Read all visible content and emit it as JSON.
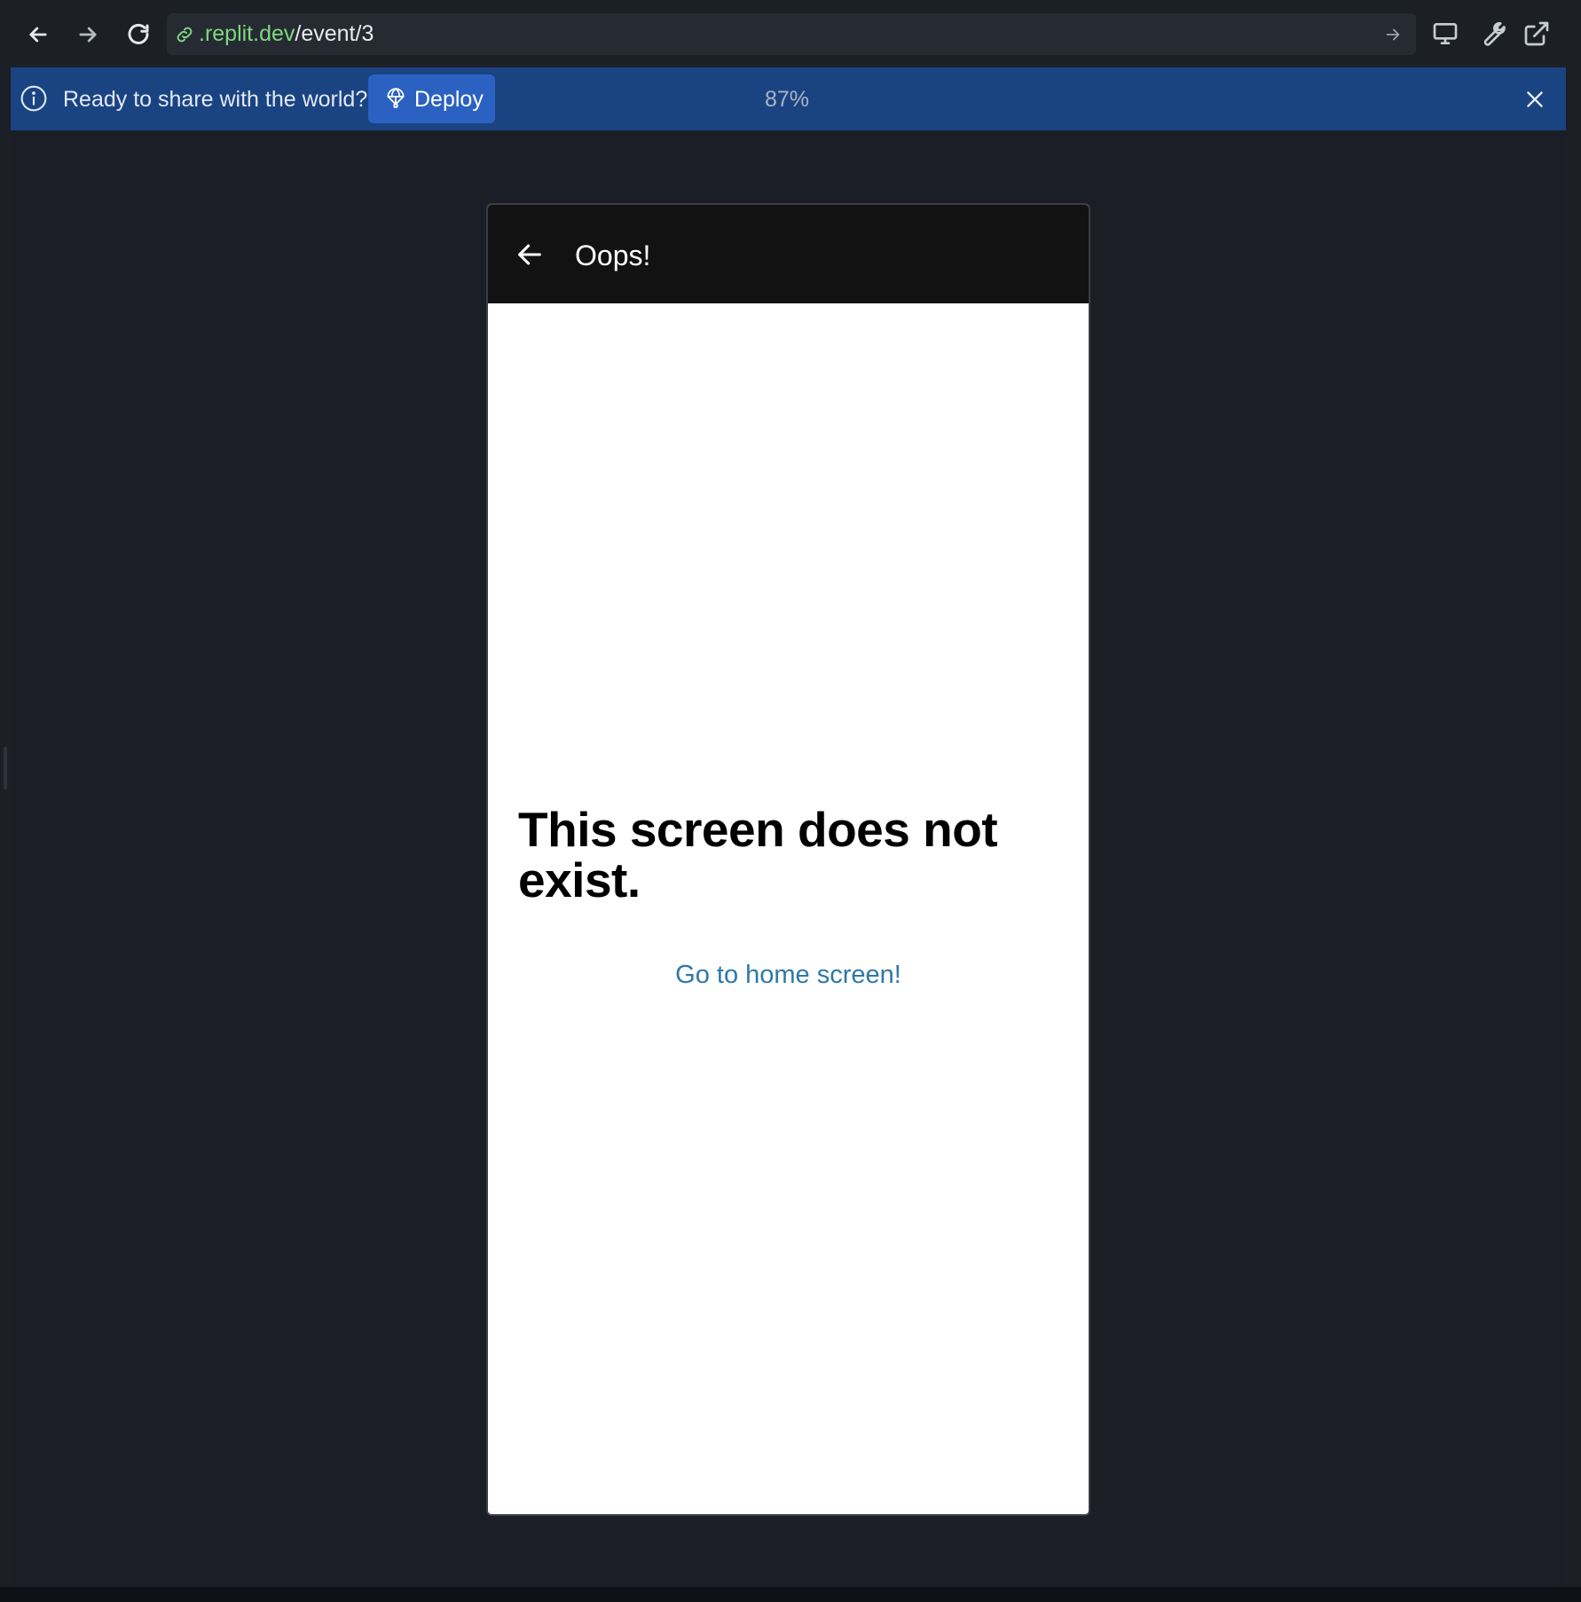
{
  "browser": {
    "url_domain": ".replit.dev",
    "url_path": "/event/3"
  },
  "banner": {
    "message": "Ready to share with the world?",
    "deploy_label": "Deploy",
    "zoom": "87%"
  },
  "app": {
    "header_title": "Oops!",
    "error_heading": "This screen does not exist.",
    "home_link": "Go to home screen!"
  },
  "colors": {
    "banner_bg": "#1a4382",
    "deploy_bg": "#2b62c2",
    "url_domain": "#7dd87d",
    "link": "#2e78a8",
    "phone_header_bg": "#121212"
  },
  "icons": {
    "nav": [
      "arrow-left-icon",
      "arrow-right-icon",
      "reload-icon"
    ],
    "url": [
      "link-icon",
      "go-arrow-icon"
    ],
    "tools": [
      "monitor-icon",
      "wrench-icon",
      "external-link-icon"
    ],
    "banner": [
      "info-icon",
      "deploy-icon",
      "close-icon"
    ],
    "app": [
      "back-arrow-icon"
    ]
  }
}
